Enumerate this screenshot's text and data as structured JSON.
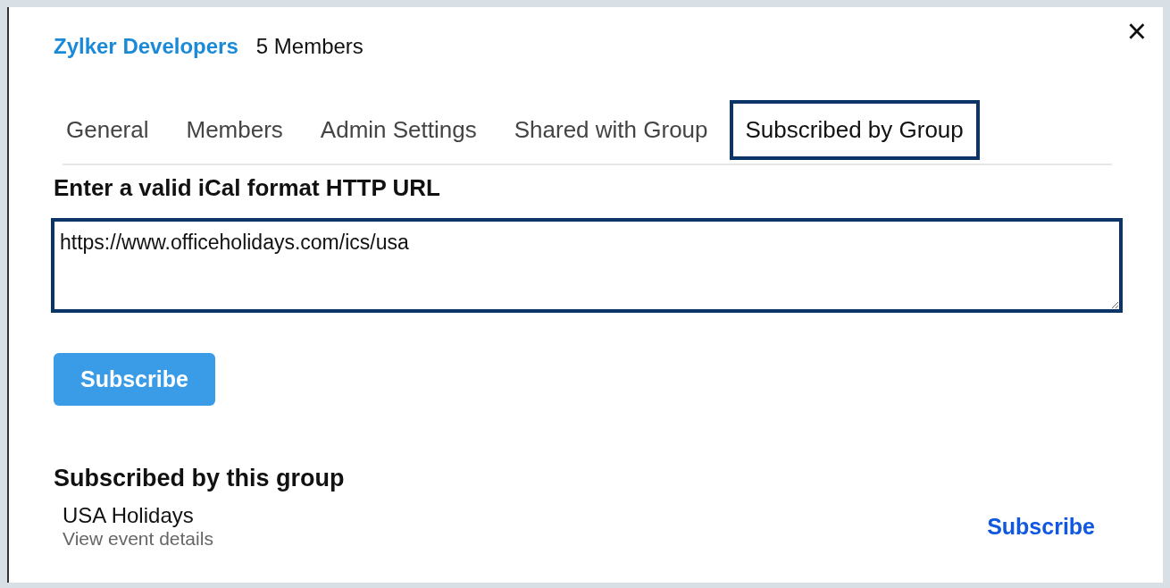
{
  "header": {
    "group_name": "Zylker Developers",
    "member_count": "5 Members"
  },
  "close": {
    "glyph": "×"
  },
  "tabs": [
    {
      "label": "General",
      "selected": false
    },
    {
      "label": "Members",
      "selected": false
    },
    {
      "label": "Admin Settings",
      "selected": false
    },
    {
      "label": "Shared with Group",
      "selected": false
    },
    {
      "label": "Subscribed by Group",
      "selected": true
    }
  ],
  "url_form": {
    "label": "Enter a valid iCal format HTTP URL",
    "value": "https://www.officeholidays.com/ics/usa",
    "button": "Subscribe"
  },
  "subscriptions": {
    "heading": "Subscribed by this group",
    "items": [
      {
        "title": "USA Holidays",
        "details_link": "View event details",
        "action": "Subscribe"
      }
    ]
  }
}
